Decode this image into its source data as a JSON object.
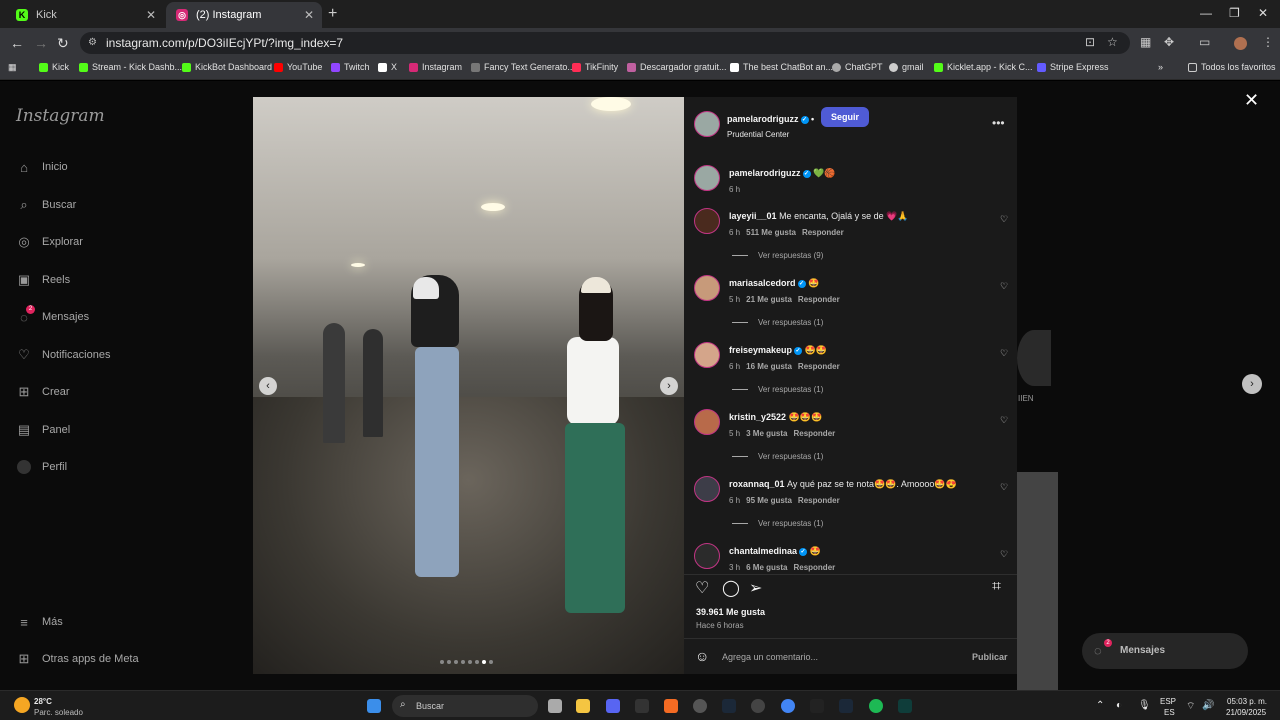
{
  "browser": {
    "tabs": [
      {
        "title": "Kick",
        "active": false
      },
      {
        "title": "(2) Instagram",
        "active": true
      }
    ],
    "url": "instagram.com/p/DO3iIEcjYPt/?img_index=7",
    "bookmarks": [
      "Kick",
      "Stream - Kick Dashb...",
      "KickBot Dashboard",
      "YouTube",
      "Twitch",
      "X",
      "Instagram",
      "Fancy Text Generato...",
      "TikFinity",
      "Descargador gratuit...",
      "The best ChatBot an...",
      "ChatGPT",
      "gmail",
      "Kicklet.app - Kick C...",
      "Stripe Express"
    ],
    "all_bookmarks": "Todos los favoritos"
  },
  "sidebar": {
    "logo": "Instagram",
    "items": [
      {
        "label": "Inicio",
        "icon": "home-icon"
      },
      {
        "label": "Buscar",
        "icon": "search-icon"
      },
      {
        "label": "Explorar",
        "icon": "compass-icon"
      },
      {
        "label": "Reels",
        "icon": "reels-icon"
      },
      {
        "label": "Mensajes",
        "icon": "messenger-icon",
        "badge": "2"
      },
      {
        "label": "Notificaciones",
        "icon": "heart-icon"
      },
      {
        "label": "Crear",
        "icon": "plus-icon"
      },
      {
        "label": "Panel",
        "icon": "chart-icon"
      },
      {
        "label": "Perfil",
        "icon": "avatar-icon"
      }
    ],
    "more": "Más",
    "meta_apps": "Otras apps de Meta"
  },
  "post": {
    "author": "pamelarodriguzz",
    "follow": "Seguir",
    "location": "Prudential Center",
    "caption_user": "pamelarodriguzz",
    "caption_emoji": "💚🏀",
    "caption_time": "6 h",
    "comments": [
      {
        "user": "layeyii__01",
        "text": "Me encanta, Ojalá y se de 💗🙏",
        "time": "6 h",
        "likes": "511 Me gusta",
        "reply": "Responder",
        "replies": "Ver respuestas (9)",
        "verified": false
      },
      {
        "user": "mariasalcedord",
        "text": "🤩",
        "time": "5 h",
        "likes": "21 Me gusta",
        "reply": "Responder",
        "replies": "Ver respuestas (1)",
        "verified": true
      },
      {
        "user": "freiseymakeup",
        "text": "🤩🤩",
        "time": "6 h",
        "likes": "16 Me gusta",
        "reply": "Responder",
        "replies": "Ver respuestas (1)",
        "verified": true
      },
      {
        "user": "kristin_y2522",
        "text": "🤩🤩🤩",
        "time": "5 h",
        "likes": "3 Me gusta",
        "reply": "Responder",
        "replies": "Ver respuestas (1)",
        "verified": false
      },
      {
        "user": "roxannaq_01",
        "text": "Ay qué paz se te nota🤩🤩. Amoooo🤩😍",
        "time": "6 h",
        "likes": "95 Me gusta",
        "reply": "Responder",
        "replies": "Ver respuestas (1)",
        "verified": false
      },
      {
        "user": "chantalmedinaa",
        "text": "🤩",
        "time": "3 h",
        "likes": "6 Me gusta",
        "reply": "Responder",
        "replies": "",
        "verified": true
      }
    ],
    "likes": "39.961 Me gusta",
    "posted": "Hace 6 horas",
    "comment_placeholder": "Agrega un comentario...",
    "publish": "Publicar",
    "carousel_total": 8,
    "carousel_index": 7
  },
  "background": {
    "messages_label": "Mensajes",
    "messages_badge": "2",
    "right_label": "IIEN"
  },
  "taskbar": {
    "weather_temp": "28°C",
    "weather_desc": "Parc. soleado",
    "search": "Buscar",
    "lang1": "ESP",
    "lang2": "ES",
    "time": "05:03 p. m.",
    "date": "21/09/2025"
  },
  "colors": {
    "accent": "#4f5bd5",
    "verified": "#0095f6",
    "panel_bg": "#1a1a1a"
  }
}
